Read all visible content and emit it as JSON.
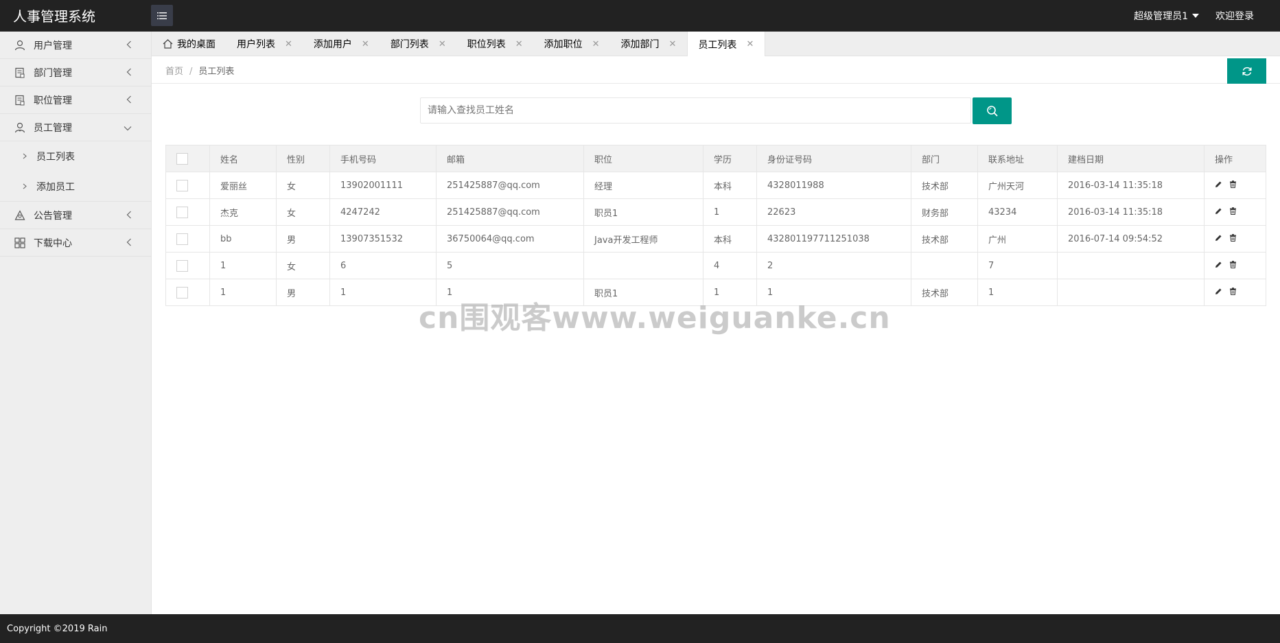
{
  "header": {
    "title": "人事管理系统",
    "admin_label": "超级管理员1",
    "welcome_label": "欢迎登录"
  },
  "sidebar": {
    "items": [
      {
        "label": "用户管理",
        "icon": "user-icon"
      },
      {
        "label": "部门管理",
        "icon": "department-icon"
      },
      {
        "label": "职位管理",
        "icon": "position-icon"
      },
      {
        "label": "员工管理",
        "icon": "employee-icon"
      },
      {
        "label": "公告管理",
        "icon": "notice-icon"
      },
      {
        "label": "下载中心",
        "icon": "grid-icon"
      }
    ],
    "subitems": [
      {
        "label": "员工列表"
      },
      {
        "label": "添加员工"
      }
    ]
  },
  "tabs": [
    {
      "label": "我的桌面"
    },
    {
      "label": "用户列表"
    },
    {
      "label": "添加用户"
    },
    {
      "label": "部门列表"
    },
    {
      "label": "职位列表"
    },
    {
      "label": "添加职位"
    },
    {
      "label": "添加部门"
    },
    {
      "label": "员工列表"
    }
  ],
  "breadcrumb": {
    "home": "首页",
    "sep": "/",
    "current": "员工列表"
  },
  "search": {
    "placeholder": "请输入查找员工姓名",
    "value": ""
  },
  "table": {
    "headers": [
      "姓名",
      "性别",
      "手机号码",
      "邮箱",
      "职位",
      "学历",
      "身份证号码",
      "部门",
      "联系地址",
      "建档日期",
      "操作"
    ],
    "rows": [
      [
        "爱丽丝",
        "女",
        "13902001111",
        "251425887@qq.com",
        "经理",
        "本科",
        "4328011988",
        "技术部",
        "广州天河",
        "2016-03-14 11:35:18"
      ],
      [
        "杰克",
        "女",
        "4247242",
        "251425887@qq.com",
        "职员1",
        "1",
        "22623",
        "财务部",
        "43234",
        "2016-03-14 11:35:18"
      ],
      [
        "bb",
        "男",
        "13907351532",
        "36750064@qq.com",
        "Java开发工程师",
        "本科",
        "432801197711251038",
        "技术部",
        "广州",
        "2016-07-14 09:54:52"
      ],
      [
        "1",
        "女",
        "6",
        "5",
        "",
        "4",
        "2",
        "",
        "7",
        ""
      ],
      [
        "1",
        "男",
        "1",
        "1",
        "职员1",
        "1",
        "1",
        "技术部",
        "1",
        ""
      ]
    ]
  },
  "watermark": "cn围观客www.weiguanke.cn",
  "footer": {
    "text": "Copyright ©2019 Rain"
  },
  "colors": {
    "accent": "#009688",
    "header_bg": "#222222"
  }
}
